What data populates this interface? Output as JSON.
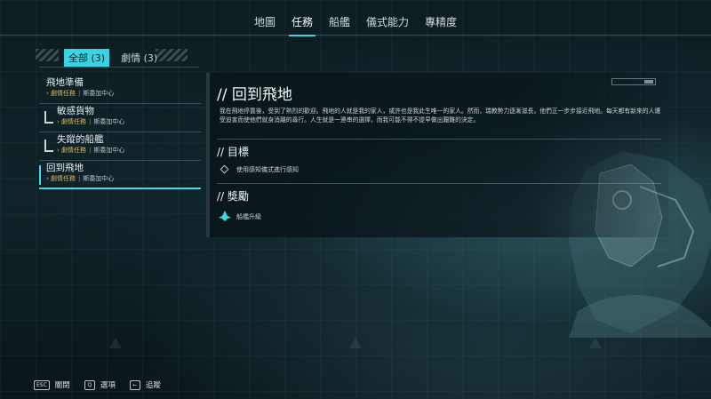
{
  "topnav": {
    "tabs": [
      {
        "label": "地圖",
        "active": false
      },
      {
        "label": "任務",
        "active": true
      },
      {
        "label": "船艦",
        "active": false
      },
      {
        "label": "儀式能力",
        "active": false
      },
      {
        "label": "專精度",
        "active": false
      }
    ]
  },
  "filters": [
    {
      "label": "全部 (3)",
      "active": true
    },
    {
      "label": "劇情 (3)",
      "active": false
    }
  ],
  "quests": [
    {
      "title": "飛地準備",
      "type": "劇情任務",
      "location": "斯委加中心",
      "indented": false,
      "selected": false
    },
    {
      "title": "敏感貨物",
      "type": "劇情任務",
      "location": "斯委加中心",
      "indented": true,
      "selected": false
    },
    {
      "title": "失蹤的船艦",
      "type": "劇情任務",
      "location": "斯委加中心",
      "indented": true,
      "selected": false
    },
    {
      "title": "回到飛地",
      "type": "劇情任務",
      "location": "斯委加中心",
      "indented": false,
      "selected": true
    }
  ],
  "detail": {
    "title": "// 回到飛地",
    "description": "我在飛地停靠後，受到了熱烈的歡迎。飛地的人就是我的家人，或許也是我此生唯一的家人。然而，瑞教勢力逐漸滋長，他們正一步步接近飛地。每天都有新來的人遭受迫害而使他們就身消離的尋行。人生就是一連串的選擇，而我可能不得不提早做出艱難的決定。",
    "objectives_header": "// 目標",
    "objective": "使用感知儀式進行感知",
    "rewards_header": "// 獎勵",
    "reward": "船艦升級"
  },
  "controls": [
    {
      "key": "ESC",
      "label": "關閉"
    },
    {
      "key": "Q",
      "label": "選項"
    },
    {
      "key": "←",
      "label": "追蹤"
    }
  ],
  "colors": {
    "accent": "#3fd8e6",
    "quest_type": "#e8b84a"
  }
}
